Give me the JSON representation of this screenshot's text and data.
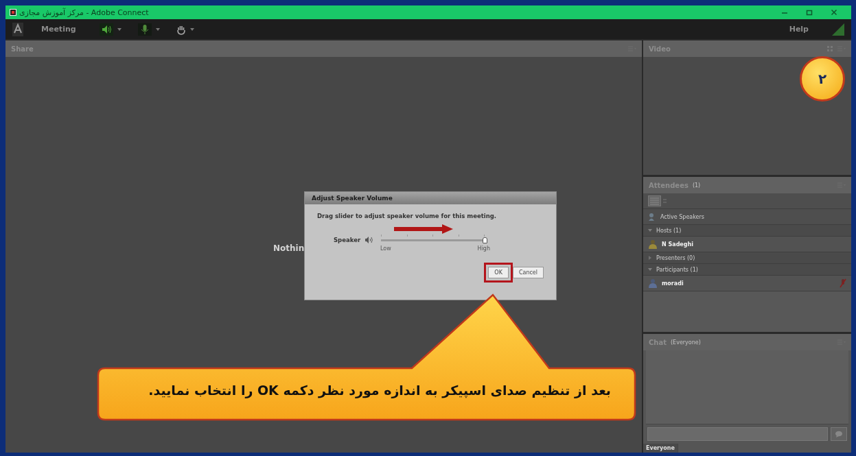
{
  "window": {
    "title": "مرکز آموزش مجازی - Adobe Connect"
  },
  "toolbar": {
    "menu": "Meeting",
    "help": "Help"
  },
  "share_pod": {
    "title": "Share",
    "message": "Nothin"
  },
  "video_pod": {
    "title": "Video"
  },
  "attendees_pod": {
    "title": "Attendees",
    "count": "(1)",
    "active_speakers": "Active Speakers",
    "groups": [
      {
        "label": "Hosts (1)",
        "expanded": true,
        "members": [
          {
            "name": "N Sadeghi",
            "kind": "host"
          }
        ]
      },
      {
        "label": "Presenters (0)",
        "expanded": false
      },
      {
        "label": "Participants (1)",
        "expanded": true,
        "members": [
          {
            "name": "moradi",
            "kind": "participant"
          }
        ]
      }
    ]
  },
  "chat_pod": {
    "title": "Chat",
    "audience": "(Everyone)",
    "tab": "Everyone"
  },
  "dialog": {
    "title": "Adjust Speaker Volume",
    "instruction": "Drag slider to adjust speaker volume for this meeting.",
    "slider": {
      "label": "Speaker",
      "level": 1,
      "min_label": "Low",
      "max_label": "High"
    },
    "buttons": [
      {
        "label": "OK",
        "highlighted": true
      },
      {
        "label": "Cancel",
        "highlighted": false
      }
    ]
  },
  "callout": {
    "text": "بعد از تنظیم صدای  اسپیکر به اندازه مورد نظر دکمه OK را انتخاب نمایید."
  },
  "step_badge": "۲"
}
